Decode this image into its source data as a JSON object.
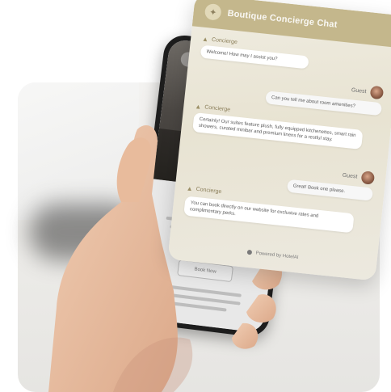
{
  "chat": {
    "title": "Boutique Concierge Chat",
    "powered_by": "Powered by HotelAI",
    "bot_name": "Concierge",
    "guest_name": "Guest",
    "messages": [
      {
        "from": "bot",
        "text": "Welcome! How may I assist you?"
      },
      {
        "from": "guest",
        "text": "Can you tell me about room amenities?"
      },
      {
        "from": "bot",
        "text": "Certainly! Our suites feature plush, fully equipped kitchenettes, smart rain showers, curated minibar and premium linens for a restful stay."
      },
      {
        "from": "guest",
        "text": "Great! Book one please."
      },
      {
        "from": "bot",
        "text": "You can book directly on our website for exclusive rates and complimentary perks."
      }
    ]
  },
  "phone": {
    "cta_label": "Book Now"
  },
  "colors": {
    "accent": "#c4b78c",
    "card_background": "#ece8db",
    "phone_body": "#1d1d1d"
  },
  "icons": {
    "logo": "concierge-bell-icon",
    "bot": "chat-bot-icon",
    "avatar": "guest-avatar"
  }
}
